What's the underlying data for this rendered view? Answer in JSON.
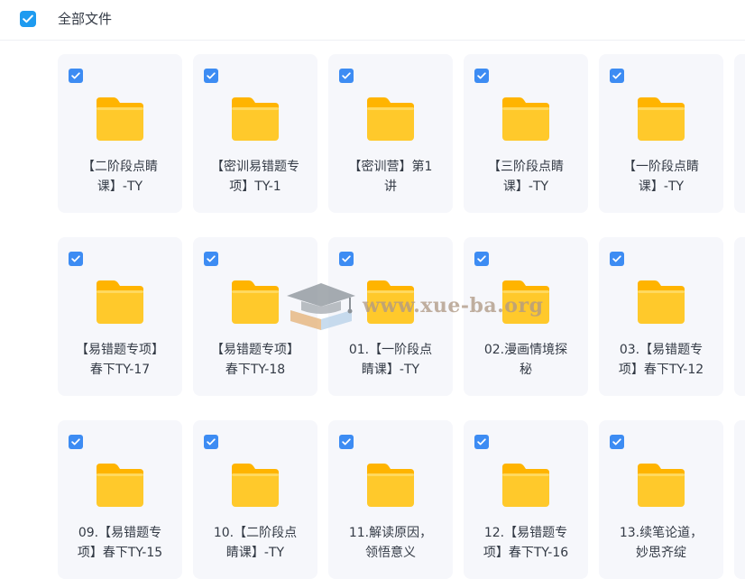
{
  "header": {
    "title": "全部文件"
  },
  "watermark": {
    "text": "www.xue-ba.org"
  },
  "colors": {
    "accent": "#1e9bf0",
    "folder_front": "#ffc92b",
    "folder_back": "#ffb400",
    "card_bg": "#f6f7fb"
  },
  "files": [
    {
      "line1": "【二阶段点睛",
      "line2": "课】-TY"
    },
    {
      "line1": "【密训易错题专",
      "line2": "项】TY-1"
    },
    {
      "line1": "【密训营】第1",
      "line2": "讲"
    },
    {
      "line1": "【三阶段点睛",
      "line2": "课】-TY"
    },
    {
      "line1": "【一阶段点睛",
      "line2": "课】-TY"
    },
    {
      "line1": "【易错题专项】",
      "line2": "春下TY-17"
    },
    {
      "line1": "【易错题专项】",
      "line2": "春下TY-18"
    },
    {
      "line1": "01.【一阶段点",
      "line2": "睛课】-TY"
    },
    {
      "line1": "02.漫画情境探",
      "line2": "秘"
    },
    {
      "line1": "03.【易错题专",
      "line2": "项】春下TY-12"
    },
    {
      "line1": "09.【易错题专",
      "line2": "项】春下TY-15"
    },
    {
      "line1": "10.【二阶段点",
      "line2": "睛课】-TY"
    },
    {
      "line1": "11.解读原因，",
      "line2": "领悟意义"
    },
    {
      "line1": "12.【易错题专",
      "line2": "项】春下TY-16"
    },
    {
      "line1": "13.续笔论道，",
      "line2": "妙思齐绽"
    }
  ]
}
